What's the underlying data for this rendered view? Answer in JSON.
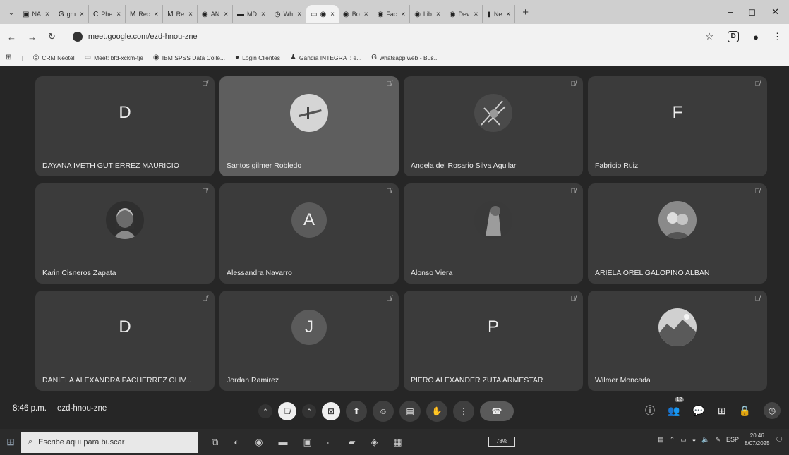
{
  "browser": {
    "tabs": [
      {
        "icon": "▣",
        "label": "NA"
      },
      {
        "icon": "G",
        "label": "gm"
      },
      {
        "icon": "C",
        "label": "Phe"
      },
      {
        "icon": "M",
        "label": "Rec"
      },
      {
        "icon": "M",
        "label": "Re"
      },
      {
        "icon": "◉",
        "label": "AN"
      },
      {
        "icon": "▬",
        "label": "MD"
      },
      {
        "icon": "◷",
        "label": "Wh"
      },
      {
        "icon": "◉",
        "label": ""
      },
      {
        "icon": "◉",
        "label": "Bo"
      },
      {
        "icon": "◉",
        "label": "Fac"
      },
      {
        "icon": "◉",
        "label": "Lib"
      },
      {
        "icon": "◉",
        "label": "Dev"
      },
      {
        "icon": "▮",
        "label": "Ne"
      }
    ],
    "url": "meet.google.com/ezd-hnou-zne",
    "bookmarks": [
      "CRM Neotel",
      "Meet: bfd-xckm-tje",
      "IBM SPSS Data Colle...",
      "Login Clientes",
      "Gandia INTEGRA :: e...",
      "whatsapp web - Bus..."
    ]
  },
  "meeting": {
    "participants": [
      {
        "name": "DAYANA IVETH GUTIERREZ MAURICIO",
        "initial": "D",
        "display": "letter"
      },
      {
        "name": "Santos gilmer Robledo",
        "initial": "",
        "display": "photo"
      },
      {
        "name": "Angela del Rosario Silva Aguilar",
        "initial": "",
        "display": "photo"
      },
      {
        "name": "Fabricio Ruiz",
        "initial": "F",
        "display": "letter"
      },
      {
        "name": "Karin Cisneros Zapata",
        "initial": "",
        "display": "photo"
      },
      {
        "name": "Alessandra Navarro",
        "initial": "A",
        "display": "circle"
      },
      {
        "name": "Alonso Viera",
        "initial": "",
        "display": "photo"
      },
      {
        "name": "ARIELA OREL GALOPINO ALBAN",
        "initial": "",
        "display": "photo"
      },
      {
        "name": "DANIELA ALEXANDRA PACHERREZ OLIV...",
        "initial": "D",
        "display": "letter"
      },
      {
        "name": "Jordan Ramirez",
        "initial": "J",
        "display": "circle"
      },
      {
        "name": "PIERO ALEXANDER ZUTA ARMESTAR",
        "initial": "P",
        "display": "letter"
      },
      {
        "name": "Wilmer Moncada",
        "initial": "",
        "display": "photo"
      }
    ],
    "time": "8:46 p.m.",
    "code": "ezd-hnou-zne",
    "participant_count": "12"
  },
  "taskbar": {
    "search_placeholder": "Escribe aquí para buscar",
    "battery": "78%",
    "language": "ESP",
    "clock_time": "20:46",
    "clock_date": "8/07/2025"
  }
}
